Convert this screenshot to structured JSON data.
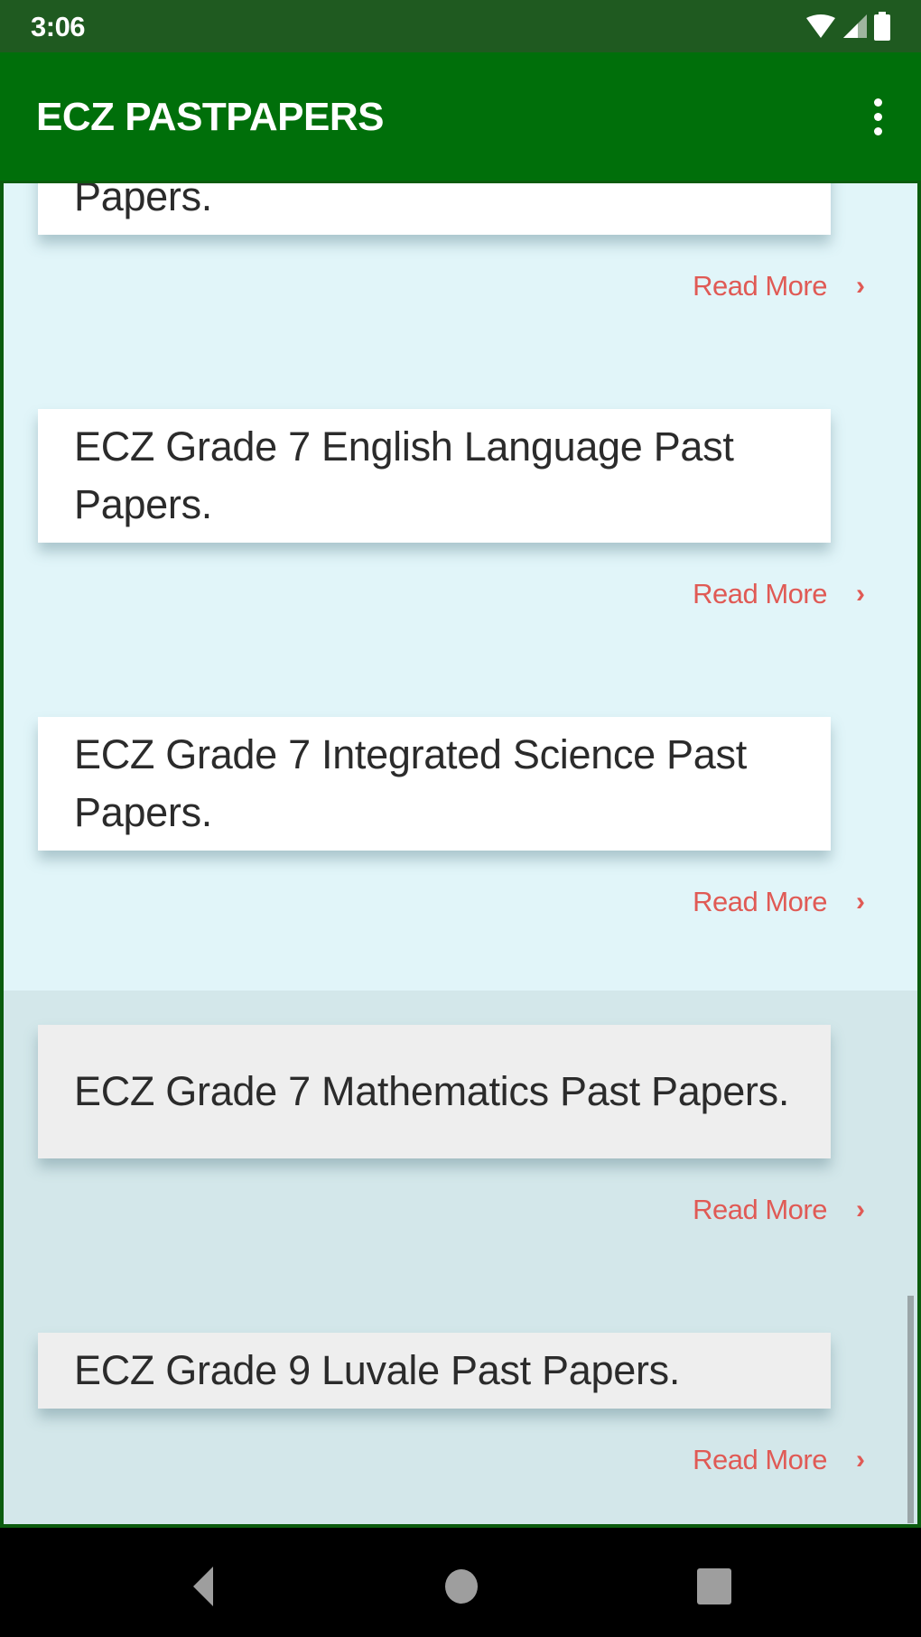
{
  "status_bar": {
    "time": "3:06",
    "icons": [
      "wifi-icon",
      "cell-signal-icon",
      "battery-icon"
    ]
  },
  "app_bar": {
    "title": "ECZ PASTPAPERS",
    "menu_icon": "more-vert-icon"
  },
  "list": {
    "items": [
      {
        "title": "Papers.",
        "read_more": "Read More",
        "partial": true
      },
      {
        "title": "ECZ Grade 7 English Language Past Papers.",
        "read_more": "Read More"
      },
      {
        "title": "ECZ Grade 7 Integrated Science Past Papers.",
        "read_more": "Read More"
      },
      {
        "title": "ECZ Grade 7 Mathematics Past Papers.",
        "read_more": "Read More"
      },
      {
        "title": "ECZ Grade 9 Luvale Past Papers.",
        "read_more": "Read More"
      }
    ]
  },
  "colors": {
    "status_bar": "#1f5a20",
    "app_bar": "#006f0a",
    "background": "#e1f5f9",
    "accent_link": "#e05a55"
  },
  "nav_bar": {
    "buttons": [
      "back-icon",
      "home-icon",
      "recents-icon"
    ]
  }
}
